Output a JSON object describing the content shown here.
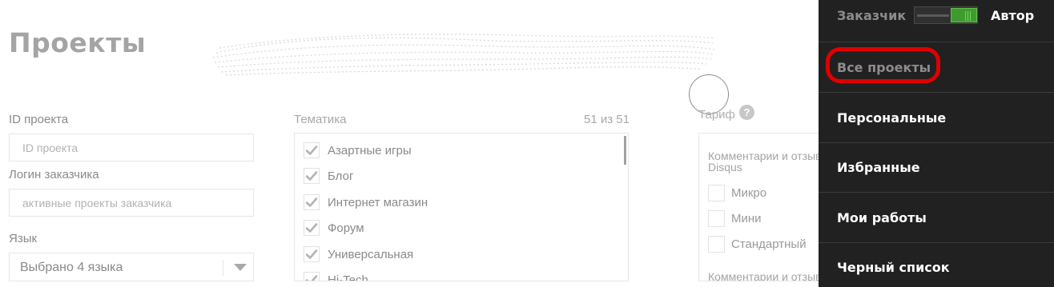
{
  "page": {
    "title": "Проекты"
  },
  "filters": {
    "project_id": {
      "label": "ID проекта",
      "placeholder": "ID проекта"
    },
    "customer_login": {
      "label": "Логин заказчика",
      "placeholder": "активные проекты заказчика"
    },
    "language": {
      "label": "Язык",
      "value": "Выбрано 4 языка"
    }
  },
  "topics": {
    "label": "Тематика",
    "count": "51 из 51",
    "items": [
      {
        "label": "Азартные игры",
        "checked": true
      },
      {
        "label": "Блог",
        "checked": true
      },
      {
        "label": "Интернет магазин",
        "checked": true
      },
      {
        "label": "Форум",
        "checked": true
      },
      {
        "label": "Универсальная",
        "checked": true
      },
      {
        "label": "Hi-Tech",
        "checked": true
      }
    ]
  },
  "tariff": {
    "label": "Тариф",
    "help": "?",
    "group1": "Комментарии и отзывы HyperComments, Disqus",
    "options": [
      "Микро",
      "Мини",
      "Стандартный"
    ],
    "group2": "Комментарии и отзывы"
  },
  "nav": {
    "role_left": "Заказчик",
    "role_right": "Автор",
    "toggle_state": "Автор",
    "active_item": "Все проекты",
    "items": [
      "Все проекты",
      "Персональные",
      "Избранные",
      "Мои работы",
      "Черный список"
    ]
  },
  "colors": {
    "panel_bg": "#212121",
    "toggle_green": "#3f9b2f",
    "highlight_red": "#e00000",
    "check_gray": "#b3b3b3"
  }
}
